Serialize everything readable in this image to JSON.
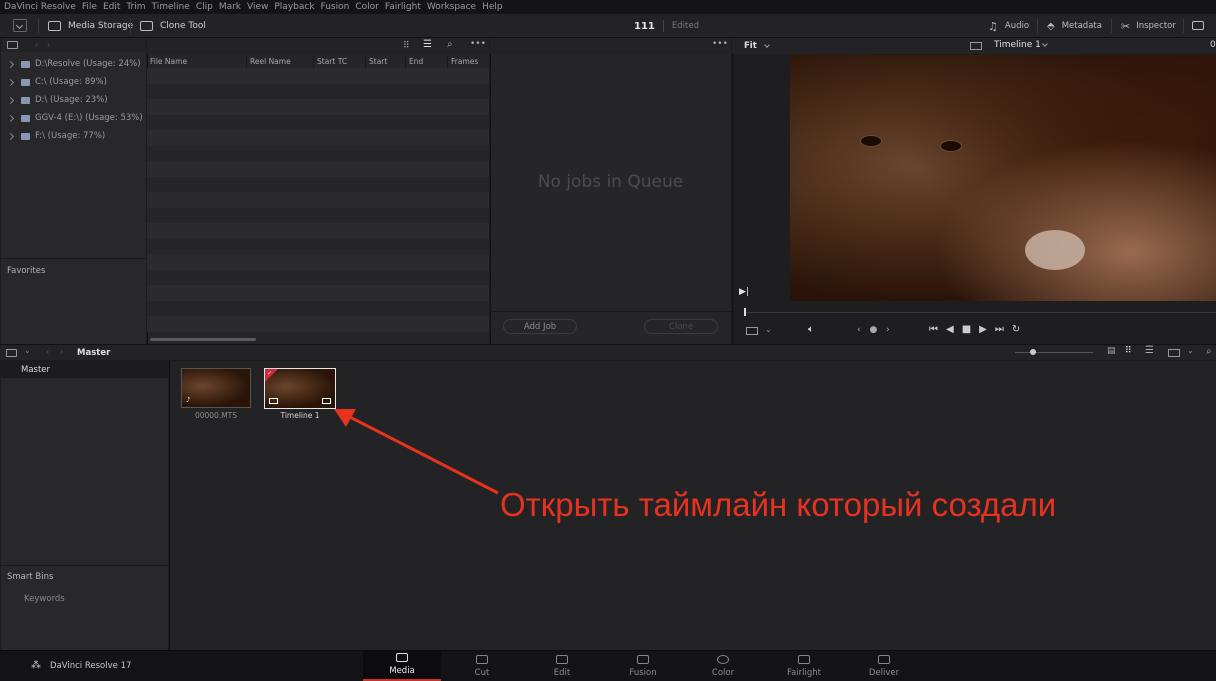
{
  "menu": [
    "DaVinci Resolve",
    "File",
    "Edit",
    "Trim",
    "Timeline",
    "Clip",
    "Mark",
    "View",
    "Playback",
    "Fusion",
    "Color",
    "Fairlight",
    "Workspace",
    "Help"
  ],
  "toolbar": {
    "media_storage": "Media Storage",
    "clone_tool": "Clone Tool",
    "project_name": "111",
    "project_status": "Edited",
    "audio": "Audio",
    "metadata": "Metadata",
    "inspector": "Inspector"
  },
  "storage": {
    "items": [
      "D:\\Resolve (Usage: 24%)",
      "C:\\ (Usage: 89%)",
      "D:\\ (Usage: 23%)",
      "GGV-4 (E:\\) (Usage: 53%)",
      "F:\\ (Usage: 77%)"
    ],
    "favorites": "Favorites"
  },
  "filelist": {
    "columns": [
      "File Name",
      "Reel Name",
      "Start TC",
      "Start",
      "End",
      "Frames"
    ]
  },
  "clone": {
    "empty": "No jobs in Queue",
    "add_job": "Add Job",
    "clone": "Clone"
  },
  "viewer": {
    "zoom": "Fit",
    "timeline": "Timeline 1",
    "timecode": "0"
  },
  "media_pool": {
    "bin_title": "Master",
    "bins_master": "Master",
    "smart_bins": "Smart Bins",
    "keywords": "Keywords",
    "clips": [
      {
        "name": "00000.MTS"
      },
      {
        "name": "Timeline 1"
      }
    ]
  },
  "annotation": {
    "text": "Открыть таймлайн который создали",
    "color": "#e6321e"
  },
  "bottom": {
    "app_name": "DaVinci Resolve 17",
    "pages": [
      "Media",
      "Cut",
      "Edit",
      "Fusion",
      "Color",
      "Fairlight",
      "Deliver"
    ],
    "active": "Media"
  }
}
